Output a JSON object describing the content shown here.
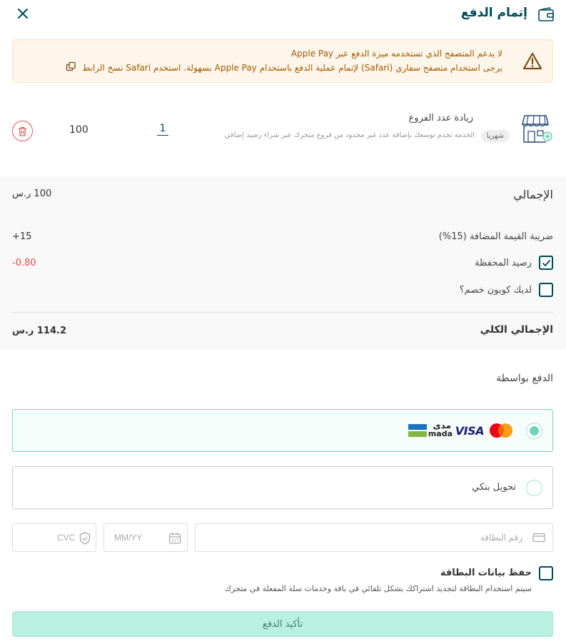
{
  "header": {
    "title": "إتمام الدفع",
    "icon": "wallet-icon",
    "close_icon": "close-icon"
  },
  "alert": {
    "line1": "لا يدعم المتصفح الذي تستخدمه ميزة الدفع عبر Apple Pay",
    "line2": "يرجى استخدام متصفح سفاري (Safari) لإتمام عملية الدفع باستخدام Apple Pay بسهولة. استخدم Safari نسخ الرابط",
    "icon": "warning-icon",
    "copy_icon": "copy-icon"
  },
  "item": {
    "title": "زيادة عدد الفروع",
    "badge": "شهريا",
    "description": "الخدمة تخدم توسعك بإضافة عدد غير محدود من فروع متجرك عبر شراء رصيد إضافي",
    "quantity": "1",
    "price": "100",
    "icon": "store-add-icon",
    "delete_icon": "trash-icon"
  },
  "summary": {
    "subtotal_label": "الإجمالي",
    "subtotal_value": "100 ر.س",
    "vat_label": "ضريبة القيمة المضافة (15%)",
    "vat_value": "+15",
    "wallet_label": "رصيد المحفظة",
    "wallet_value": "-0.80",
    "wallet_checked": true,
    "coupon_label": "لديك كوبون خصم؟",
    "coupon_checked": false,
    "total_label": "الإجمالي الكلي",
    "total_value": "114.2 ر.س"
  },
  "payment": {
    "title": "الدفع بواسطة",
    "options": [
      {
        "id": "card",
        "logos": [
          "mastercard-logo",
          "visa-logo",
          "mada-logo"
        ],
        "visa_text": "VISA",
        "mada_text_ar": "مدى",
        "mada_text_en": "mada",
        "selected": true
      },
      {
        "id": "bank",
        "label": "تحويل بنكي",
        "selected": false
      }
    ],
    "card_number_placeholder": "رقم البطاقة",
    "expiry_placeholder": "MM/YY",
    "cvc_placeholder": "CVC",
    "save_label": "حفظ بيانات البطاقة",
    "save_note": "سيتم استخدام البطاقة لتجديد اشتراكك بشكل تلقائي في باقة وخدمات سلة المفعلة في متجرك",
    "save_checked": false
  },
  "confirm_label": "تأكيد الدفع",
  "colors": {
    "primary": "#004956",
    "accent": "#76d6be",
    "danger": "#e24a4a",
    "warning_bg": "#fef6ea",
    "warning_text": "#a05a00",
    "button_bg": "#baf0df"
  }
}
